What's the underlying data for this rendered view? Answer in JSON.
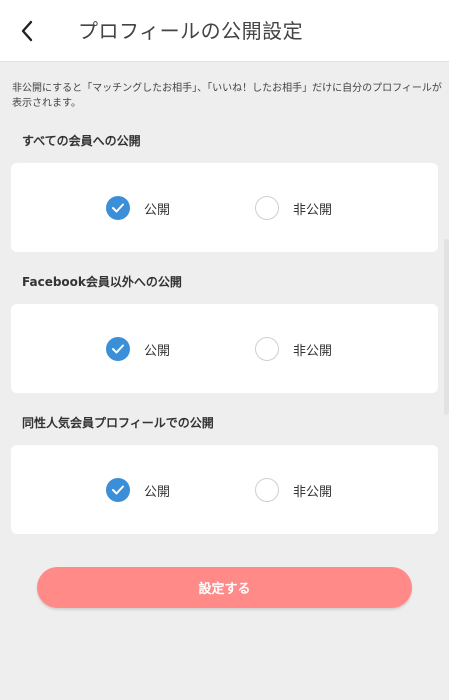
{
  "header": {
    "title": "プロフィールの公開設定",
    "back_icon": "chevron-left-icon"
  },
  "description": "非公開にすると「マッチングしたお相手」、「いいね！したお相手」だけに自分のプロフィールが表示されます。",
  "sections": [
    {
      "label": "すべての会員への公開",
      "public_label": "公開",
      "private_label": "非公開",
      "selected": "public"
    },
    {
      "label": "Facebook会員以外への公開",
      "public_label": "公開",
      "private_label": "非公開",
      "selected": "public"
    },
    {
      "label": "同性人気会員プロフィールでの公開",
      "public_label": "公開",
      "private_label": "非公開",
      "selected": "public"
    }
  ],
  "submit_label": "設定する",
  "colors": {
    "accent": "#3a8fd8",
    "button": "#ff8a87",
    "background": "#eeeeee"
  }
}
